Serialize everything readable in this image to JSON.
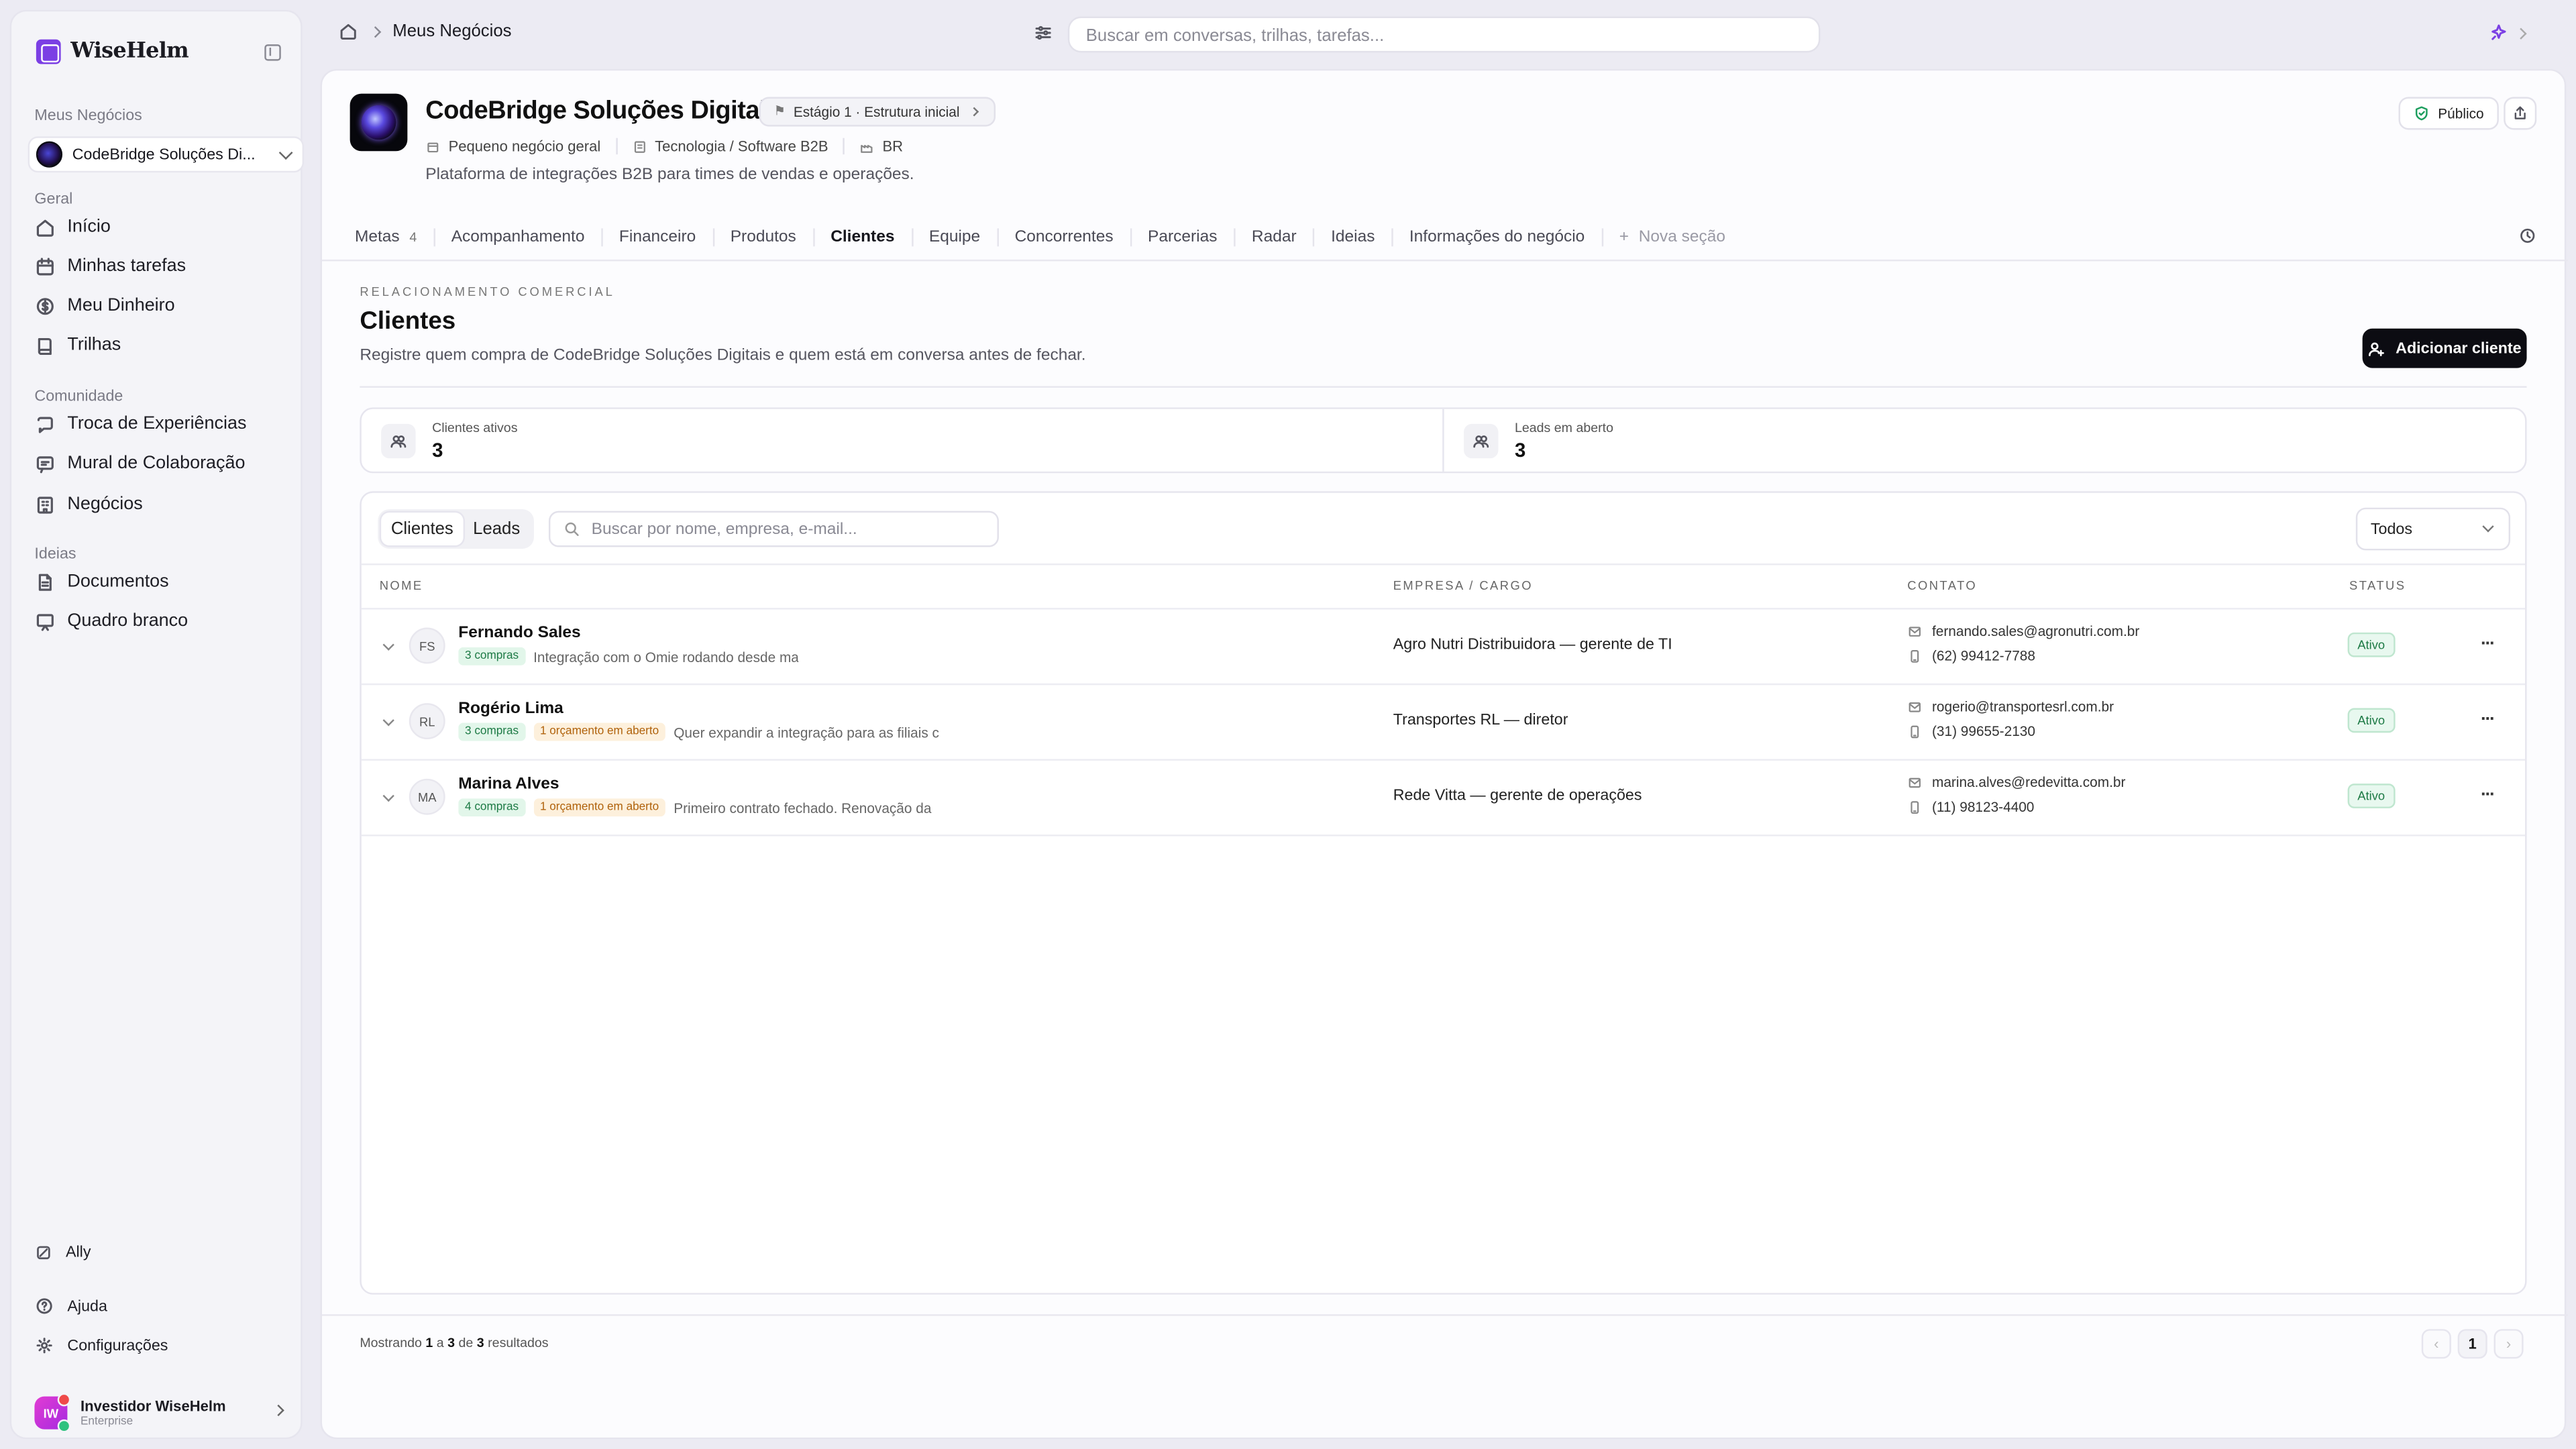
{
  "brand": {
    "name": "WiseHelm"
  },
  "sidebar": {
    "business_section": "Meus Negócios",
    "selected_business": "CodeBridge Soluções Di...",
    "sections": [
      {
        "label": "Geral",
        "items": [
          {
            "label": "Início",
            "icon": "home-icon"
          },
          {
            "label": "Minhas tarefas",
            "icon": "calendar-icon"
          },
          {
            "label": "Meu Dinheiro",
            "icon": "money-icon"
          },
          {
            "label": "Trilhas",
            "icon": "book-icon"
          }
        ]
      },
      {
        "label": "Comunidade",
        "items": [
          {
            "label": "Troca de Experiências",
            "icon": "chat-icon"
          },
          {
            "label": "Mural de Colaboração",
            "icon": "message-icon"
          },
          {
            "label": "Negócios",
            "icon": "building-icon"
          }
        ]
      },
      {
        "label": "Ideias",
        "items": [
          {
            "label": "Documentos",
            "icon": "document-icon"
          },
          {
            "label": "Quadro branco",
            "icon": "whiteboard-icon"
          }
        ]
      }
    ],
    "ally": "Ally",
    "help": "Ajuda",
    "settings": "Configurações",
    "user": {
      "initials": "IW",
      "name": "Investidor WiseHelm",
      "plan": "Enterprise"
    }
  },
  "topbar": {
    "breadcrumb": "Meus Negócios",
    "search_placeholder": "Buscar em conversas, trilhas, tarefas..."
  },
  "business": {
    "name": "CodeBridge Soluções Digitais",
    "stage": "Estágio 1 · Estrutura inicial",
    "size": "Pequeno negócio geral",
    "sector": "Tecnologia / Software B2B",
    "country": "BR",
    "description": "Plataforma de integrações B2B para times de vendas e operações.",
    "visibility": "Público"
  },
  "tabs": [
    {
      "label": "Metas",
      "count": "4"
    },
    {
      "label": "Acompanhamento"
    },
    {
      "label": "Financeiro"
    },
    {
      "label": "Produtos"
    },
    {
      "label": "Clientes",
      "active": true
    },
    {
      "label": "Equipe"
    },
    {
      "label": "Concorrentes"
    },
    {
      "label": "Parcerias"
    },
    {
      "label": "Radar"
    },
    {
      "label": "Ideias"
    },
    {
      "label": "Informações do negócio"
    },
    {
      "label": "Nova seção"
    }
  ],
  "section": {
    "kicker": "RELACIONAMENTO COMERCIAL",
    "title": "Clientes",
    "subtitle": "Registre quem compra de CodeBridge Soluções Digitais e quem está em conversa antes de fechar.",
    "add_button": "Adicionar cliente"
  },
  "stats": [
    {
      "label": "Clientes ativos",
      "value": "3"
    },
    {
      "label": "Leads em aberto",
      "value": "3"
    }
  ],
  "table": {
    "segments": [
      "Clientes",
      "Leads"
    ],
    "search_placeholder": "Buscar por nome, empresa, e-mail...",
    "filter": "Todos",
    "headers": [
      "NOME",
      "EMPRESA / CARGO",
      "CONTATO",
      "STATUS"
    ],
    "rows": [
      {
        "initials": "FS",
        "name": "Fernando Sales",
        "purchases": "3 compras",
        "open_quote": "",
        "note": "Integração com o Omie rodando desde ma",
        "company": "Agro Nutri Distribuidora — gerente de TI",
        "email": "fernando.sales@agronutri.com.br",
        "phone": "(62) 99412-7788",
        "status": "Ativo"
      },
      {
        "initials": "RL",
        "name": "Rogério Lima",
        "purchases": "3 compras",
        "open_quote": "1 orçamento em aberto",
        "note": "Quer expandir a integração para as filiais c",
        "company": "Transportes RL — diretor",
        "email": "rogerio@transportesrl.com.br",
        "phone": "(31) 99655-2130",
        "status": "Ativo"
      },
      {
        "initials": "MA",
        "name": "Marina Alves",
        "purchases": "4 compras",
        "open_quote": "1 orçamento em aberto",
        "note": "Primeiro contrato fechado. Renovação da",
        "company": "Rede Vitta — gerente de operações",
        "email": "marina.alves@redevitta.com.br",
        "phone": "(11) 98123-4400",
        "status": "Ativo"
      }
    ]
  },
  "footer": {
    "showing_prefix": "Mostrando",
    "from": "1",
    "sep_a": "a",
    "to": "3",
    "sep_de": "de",
    "total": "3",
    "suffix": "resultados",
    "page": "1"
  }
}
